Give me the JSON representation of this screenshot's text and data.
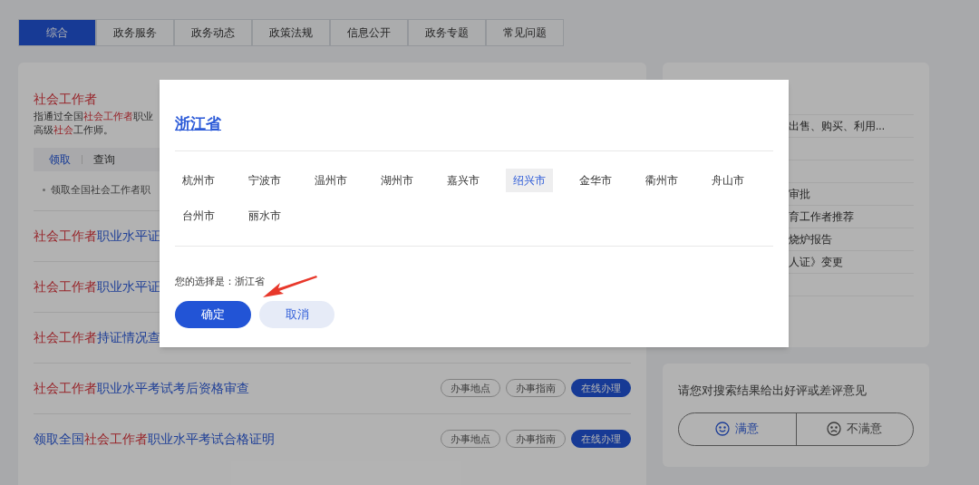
{
  "tabs": [
    {
      "label": "综合",
      "selected": true
    },
    {
      "label": "政务服务",
      "selected": false
    },
    {
      "label": "政务动态",
      "selected": false
    },
    {
      "label": "政策法规",
      "selected": false
    },
    {
      "label": "信息公开",
      "selected": false
    },
    {
      "label": "政务专题",
      "selected": false
    },
    {
      "label": "常见问题",
      "selected": false
    }
  ],
  "results": {
    "title": "社会工作者",
    "description": [
      [
        {
          "text": "指通过全国",
          "highlight": false
        },
        {
          "text": "社会工作者",
          "highlight": true
        },
        {
          "text": "职业",
          "highlight": false
        }
      ],
      [
        {
          "text": "高级",
          "highlight": false
        },
        {
          "text": "社会",
          "highlight": true
        },
        {
          "text": "工作师。",
          "highlight": false
        }
      ]
    ],
    "sub_tabs": [
      {
        "label": "领取",
        "selected": true
      },
      {
        "label": "查询",
        "selected": false
      }
    ],
    "bullet": "领取全国社会工作者职",
    "items": [
      {
        "title": [
          {
            "text": "社会工作者",
            "highlight": true
          },
          {
            "text": "职业水平证",
            "highlight": false
          }
        ]
      },
      {
        "title": [
          {
            "text": "社会工作者",
            "highlight": true
          },
          {
            "text": "职业水平证",
            "highlight": false
          }
        ]
      },
      {
        "title": [
          {
            "text": "社会工作者",
            "highlight": true
          },
          {
            "text": "持证情况查",
            "highlight": false
          }
        ]
      },
      {
        "title": [
          {
            "text": "社会工作者",
            "highlight": true
          },
          {
            "text": "职业水平考试考后资格审查",
            "highlight": false
          }
        ],
        "actions": [
          {
            "label": "办事地点",
            "kind": "outline"
          },
          {
            "label": "办事指南",
            "kind": "outline"
          },
          {
            "label": "在线办理",
            "kind": "primary"
          }
        ]
      },
      {
        "title": [
          {
            "text": "领取全国",
            "highlight": false
          },
          {
            "text": "社会工作者",
            "highlight": true
          },
          {
            "text": "职业水平考试合格证明",
            "highlight": false
          }
        ],
        "actions": [
          {
            "label": "办事地点",
            "kind": "outline"
          },
          {
            "label": "办事指南",
            "kind": "outline"
          },
          {
            "label": "在线办理",
            "kind": "primary"
          }
        ]
      }
    ]
  },
  "side_list": [
    {
      "kind": "link",
      "text": "出售、购买、利用..."
    },
    {
      "kind": "blank"
    },
    {
      "kind": "blank"
    },
    {
      "kind": "link",
      "text": "审批"
    },
    {
      "kind": "link",
      "text": "育工作者推荐"
    },
    {
      "kind": "link",
      "text": "烧炉报告"
    },
    {
      "kind": "link",
      "text": "人证》变更"
    },
    {
      "kind": "blank"
    },
    {
      "kind": "blank"
    }
  ],
  "feedback": {
    "prompt": "请您对搜索结果给出好评或差评意见",
    "options": [
      {
        "label": "满意",
        "kind": "good",
        "selected": true
      },
      {
        "label": "不满意",
        "kind": "bad",
        "selected": false
      }
    ]
  },
  "dialog": {
    "province": "浙江省",
    "cities": [
      {
        "name": "杭州市",
        "selected": false
      },
      {
        "name": "宁波市",
        "selected": false
      },
      {
        "name": "温州市",
        "selected": false
      },
      {
        "name": "湖州市",
        "selected": false
      },
      {
        "name": "嘉兴市",
        "selected": false
      },
      {
        "name": "绍兴市",
        "selected": true
      },
      {
        "name": "金华市",
        "selected": false
      },
      {
        "name": "衢州市",
        "selected": false
      },
      {
        "name": "舟山市",
        "selected": false
      },
      {
        "name": "台州市",
        "selected": false
      },
      {
        "name": "丽水市",
        "selected": false
      }
    ],
    "choice": "您的选择是：浙江省",
    "confirm": "确定",
    "cancel": "取消"
  }
}
